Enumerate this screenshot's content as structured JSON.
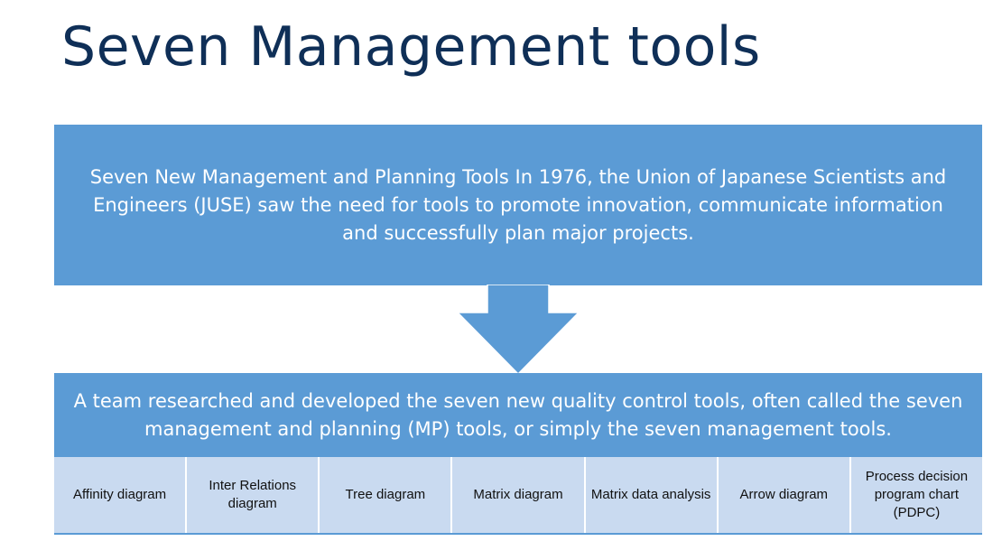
{
  "title": "Seven Management tools",
  "top_box": {
    "text": "Seven New Management and Planning Tools In 1976, the Union of Japanese Scientists and Engineers (JUSE) saw the need for tools to promote innovation, communicate information and successfully plan major projects."
  },
  "bottom_box": {
    "text": "A team researched and developed the seven new quality control tools, often called the seven management and planning (MP) tools, or simply the seven management tools."
  },
  "tools": [
    {
      "label": "Affinity diagram"
    },
    {
      "label": "Inter Relations diagram"
    },
    {
      "label": "Tree diagram"
    },
    {
      "label": "Matrix diagram"
    },
    {
      "label": "Matrix data analysis"
    },
    {
      "label": "Arrow diagram"
    },
    {
      "label": "Process decision program chart (PDPC)"
    }
  ],
  "colors": {
    "title": "#0f2f57",
    "box_fill": "#5b9bd5",
    "cell_fill": "#c9daf0",
    "box_text": "#ffffff",
    "cell_text": "#111111"
  }
}
